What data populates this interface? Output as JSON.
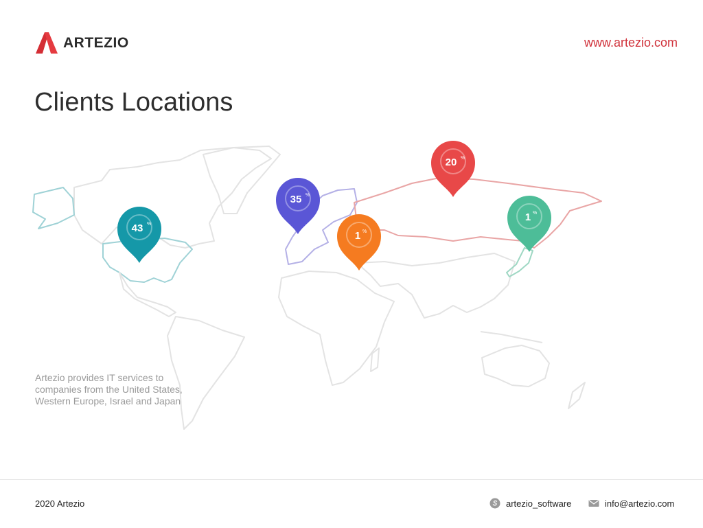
{
  "header": {
    "logo_text": "ARTEZIO",
    "website": "www.artezio.com"
  },
  "page_title": "Clients Locations",
  "map": {
    "pins": [
      {
        "id": "usa",
        "label": "43",
        "unit": "%",
        "color": "#1598a8",
        "value": 43
      },
      {
        "id": "western-europe",
        "label": "35",
        "unit": "%",
        "color": "#5a56d6",
        "value": 35
      },
      {
        "id": "israel",
        "label": "1",
        "unit": "%",
        "color": "#f57b20",
        "value": 1
      },
      {
        "id": "russia",
        "label": "20",
        "unit": "%",
        "color": "#e84848",
        "value": 20
      },
      {
        "id": "japan",
        "label": "1",
        "unit": "%",
        "color": "#4dbd98",
        "value": 1
      }
    ],
    "land_color": "#e2e2e2"
  },
  "description": "Artezio provides IT services to companies from the United States, Western Europe, Israel and Japan",
  "footer": {
    "copyright": "2020 Artezio",
    "skype": "artezio_software",
    "email": "info@artezio.com",
    "skype_icon": "skype-icon",
    "email_icon": "envelope-icon"
  }
}
